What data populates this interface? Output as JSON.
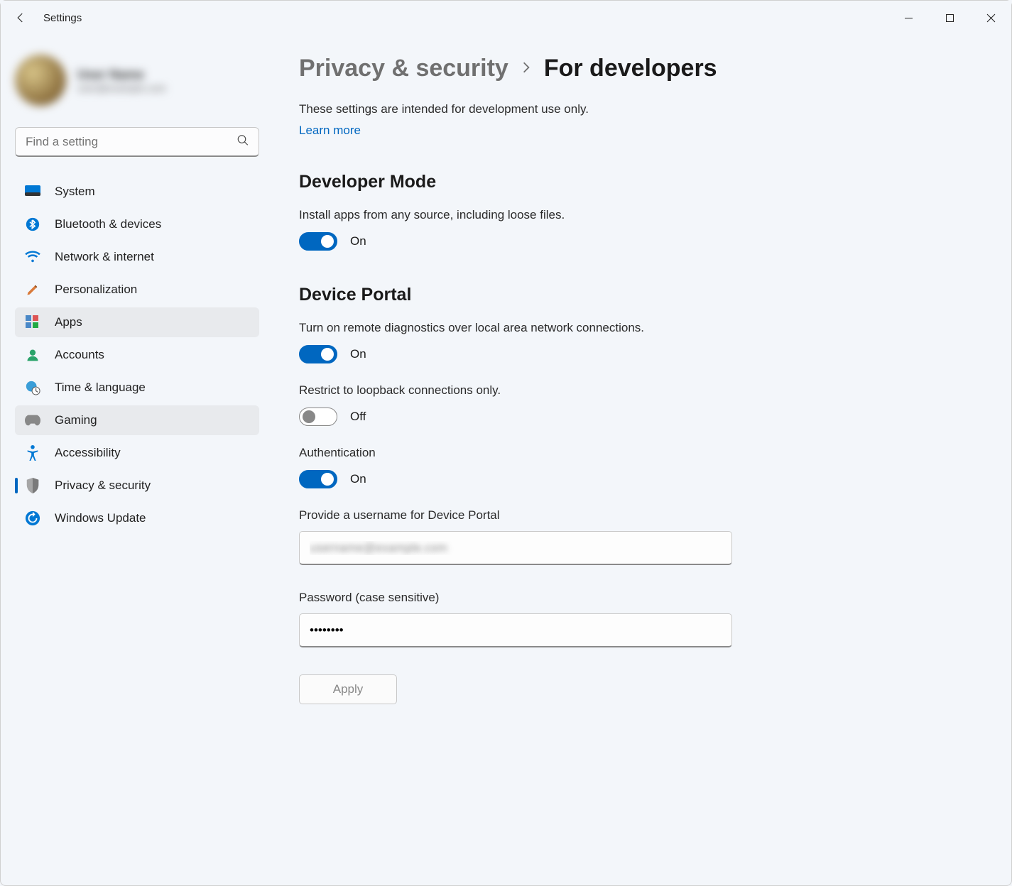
{
  "app": {
    "title": "Settings"
  },
  "profile": {
    "name": "User Name",
    "email": "user@example.com"
  },
  "search": {
    "placeholder": "Find a setting"
  },
  "nav": {
    "items": [
      {
        "label": "System"
      },
      {
        "label": "Bluetooth & devices"
      },
      {
        "label": "Network & internet"
      },
      {
        "label": "Personalization"
      },
      {
        "label": "Apps"
      },
      {
        "label": "Accounts"
      },
      {
        "label": "Time & language"
      },
      {
        "label": "Gaming"
      },
      {
        "label": "Accessibility"
      },
      {
        "label": "Privacy & security"
      },
      {
        "label": "Windows Update"
      }
    ]
  },
  "breadcrumb": {
    "parent": "Privacy & security",
    "current": "For developers"
  },
  "intro": {
    "text": "These settings are intended for development use only.",
    "learn_more": "Learn more"
  },
  "dev_mode": {
    "heading": "Developer Mode",
    "desc": "Install apps from any source, including loose files.",
    "state_label": "On"
  },
  "device_portal": {
    "heading": "Device Portal",
    "desc": "Turn on remote diagnostics over local area network connections.",
    "state_label": "On",
    "loopback_desc": "Restrict to loopback connections only.",
    "loopback_state_label": "Off",
    "auth_label": "Authentication",
    "auth_state_label": "On",
    "username_label": "Provide a username for Device Portal",
    "username_value": "username@example.com",
    "password_label": "Password (case sensitive)",
    "password_value": "password",
    "apply_label": "Apply"
  }
}
